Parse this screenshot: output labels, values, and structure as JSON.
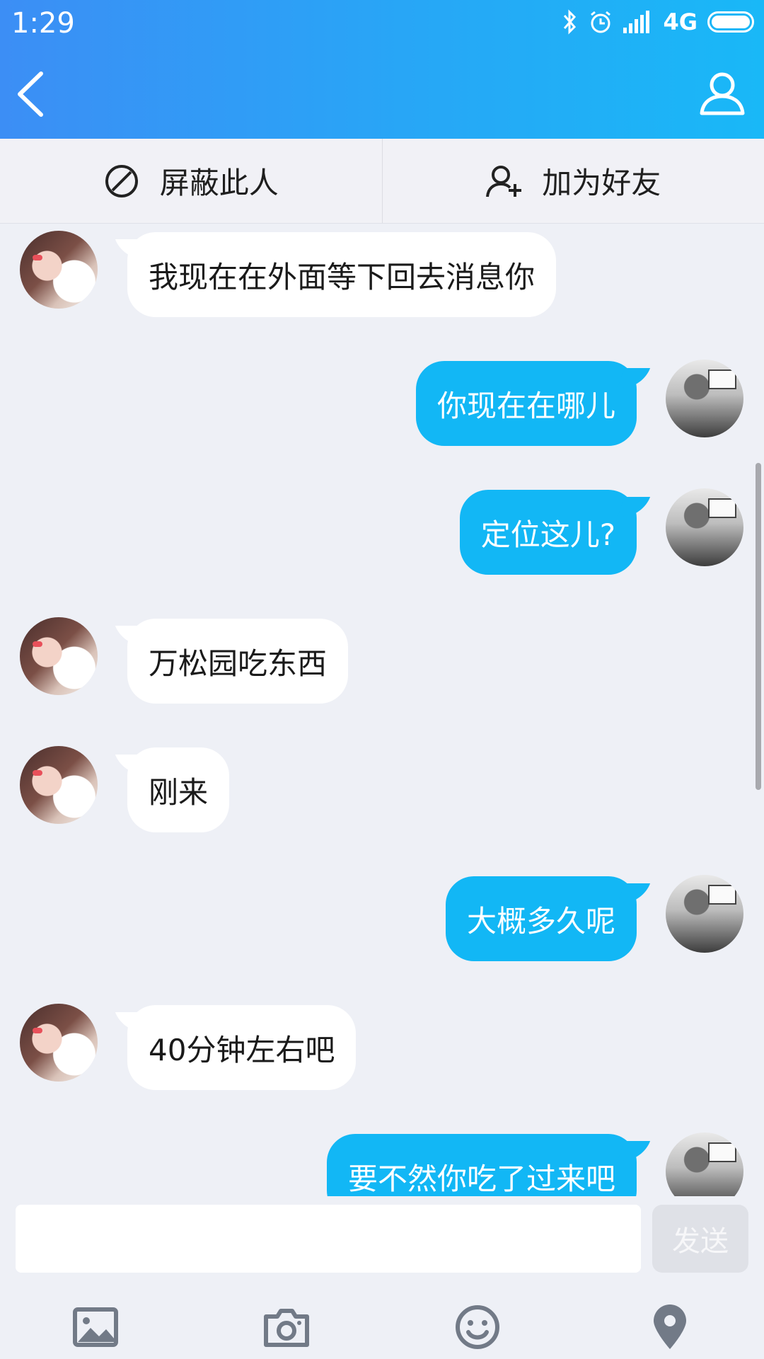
{
  "status_bar": {
    "time": "1:29",
    "network": "4G"
  },
  "header": {
    "title": ""
  },
  "actions": {
    "block_label": "屏蔽此人",
    "add_friend_label": "加为好友"
  },
  "messages": [
    {
      "side": "in",
      "text": "我现在在外面等下回去消息你"
    },
    {
      "side": "out",
      "text": "你现在在哪儿"
    },
    {
      "side": "out",
      "text": "定位这儿?"
    },
    {
      "side": "in",
      "text": "万松园吃东西"
    },
    {
      "side": "in",
      "text": "刚来"
    },
    {
      "side": "out",
      "text": "大概多久呢"
    },
    {
      "side": "in",
      "text": "40分钟左右吧"
    },
    {
      "side": "out",
      "text": "要不然你吃了过来吧"
    }
  ],
  "composer": {
    "input_value": "",
    "send_label": "发送"
  },
  "toolbar_icons": [
    "image-icon",
    "camera-icon",
    "emoji-icon",
    "location-icon"
  ],
  "colors": {
    "header_start": "#3c8ef5",
    "header_end": "#19b8f7",
    "outgoing_bubble": "#12b7f5",
    "incoming_bubble": "#ffffff",
    "background": "#eef0f6"
  }
}
